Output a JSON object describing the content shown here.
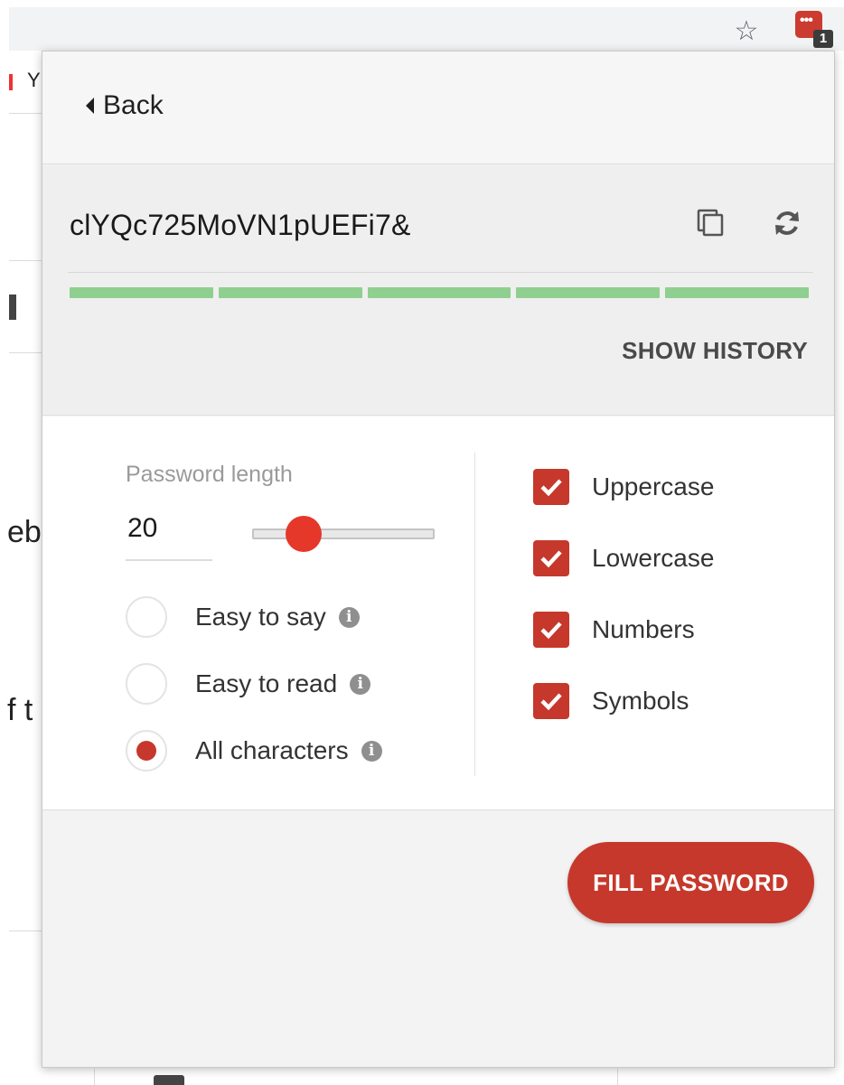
{
  "browser": {
    "star_icon": "☆",
    "extension_badge": "1",
    "bg_fragments": [
      "Y",
      "eb",
      "f t"
    ]
  },
  "popup": {
    "header": {
      "back_label": "Back"
    },
    "generator": {
      "password": "clYQc725MoVN1pUEFi7&",
      "strength_segments_filled": 5,
      "strength_segments_total": 5,
      "strength_color": "#8fcf8f",
      "show_history_label": "SHOW HISTORY"
    },
    "options": {
      "length_label": "Password length",
      "length_value": "20",
      "slider_fraction": 0.28,
      "modes": [
        {
          "label": "Easy to say",
          "checked": false
        },
        {
          "label": "Easy to read",
          "checked": false
        },
        {
          "label": "All characters",
          "checked": true
        }
      ],
      "character_sets": [
        {
          "label": "Uppercase",
          "checked": true
        },
        {
          "label": "Lowercase",
          "checked": true
        },
        {
          "label": "Numbers",
          "checked": true
        },
        {
          "label": "Symbols",
          "checked": true
        }
      ]
    },
    "footer": {
      "fill_button_label": "FILL PASSWORD"
    },
    "accent_color": "#c6382b"
  }
}
